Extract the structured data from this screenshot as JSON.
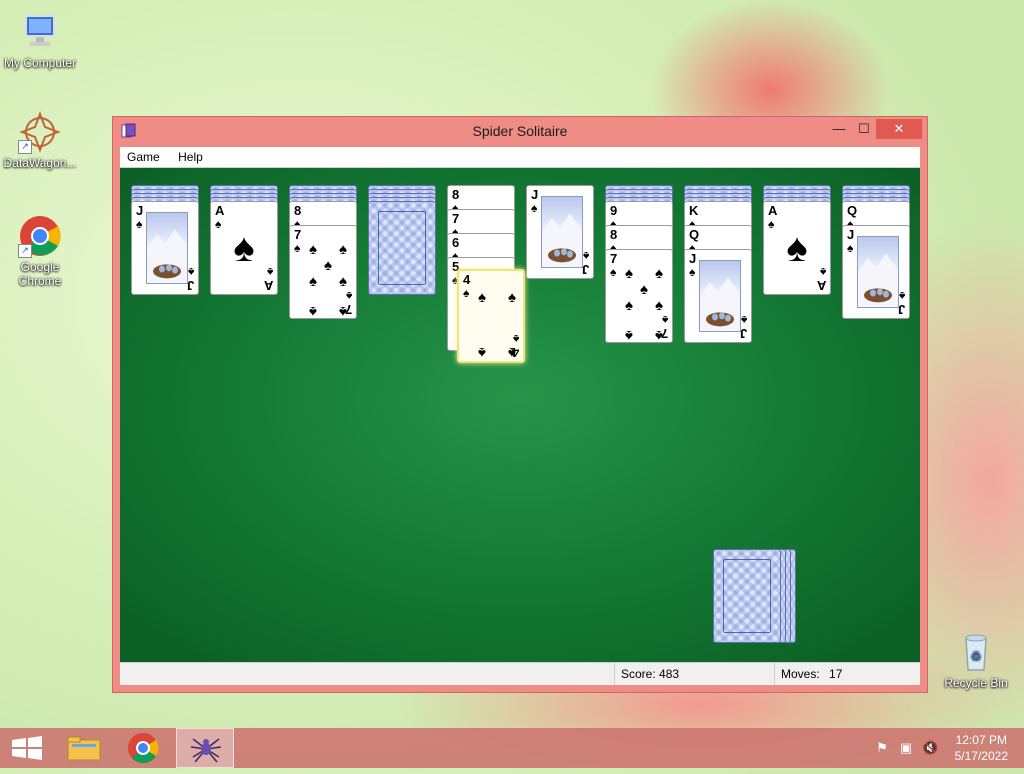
{
  "desktop": {
    "icons": [
      {
        "label": "My Computer"
      },
      {
        "label": "DataWagon..."
      },
      {
        "label": "Google Chrome"
      },
      {
        "label": "Recycle Bin"
      }
    ]
  },
  "window": {
    "title": "Spider Solitaire",
    "controls": {
      "minimize": "—",
      "maximize": "☐",
      "close": "✕"
    },
    "menu": [
      "Game",
      "Help"
    ],
    "status": {
      "score_label": "Score: 483",
      "moves_label": "Moves:",
      "moves_value": "17"
    }
  },
  "tableau": [
    {
      "backs": 4,
      "faceup": [
        {
          "rank": "J",
          "suit": "♠",
          "face": true
        }
      ]
    },
    {
      "backs": 4,
      "faceup": [
        {
          "rank": "A",
          "suit": "♠",
          "ace": true
        }
      ]
    },
    {
      "backs": 4,
      "faceup": [
        {
          "rank": "8",
          "suit": "♠"
        },
        {
          "rank": "7",
          "suit": "♠",
          "pips": 7
        }
      ]
    },
    {
      "backs": 5,
      "faceup": []
    },
    {
      "backs": 0,
      "faceup": [
        {
          "rank": "8",
          "suit": "♠"
        },
        {
          "rank": "7",
          "suit": "♠"
        },
        {
          "rank": "6",
          "suit": "♠"
        },
        {
          "rank": "5",
          "suit": "♠"
        }
      ]
    },
    {
      "backs": 0,
      "faceup": [
        {
          "rank": "J",
          "suit": "♠",
          "face": true
        }
      ]
    },
    {
      "backs": 4,
      "faceup": [
        {
          "rank": "9",
          "suit": "♠"
        },
        {
          "rank": "8",
          "suit": "♠"
        },
        {
          "rank": "7",
          "suit": "♠",
          "pips": 7
        }
      ]
    },
    {
      "backs": 4,
      "faceup": [
        {
          "rank": "K",
          "suit": "♠"
        },
        {
          "rank": "Q",
          "suit": "♠"
        },
        {
          "rank": "J",
          "suit": "♠",
          "face": true
        }
      ]
    },
    {
      "backs": 4,
      "faceup": [
        {
          "rank": "A",
          "suit": "♠",
          "ace": true
        }
      ]
    },
    {
      "backs": 4,
      "faceup": [
        {
          "rank": "Q",
          "suit": "♠"
        },
        {
          "rank": "J",
          "suit": "♠",
          "face": true
        }
      ]
    }
  ],
  "dragging_card": {
    "rank": "4",
    "suit": "♠",
    "pips": 4
  },
  "stock": {
    "piles": 4
  },
  "taskbar": {
    "clock_time": "12:07 PM",
    "clock_date": "5/17/2022"
  }
}
